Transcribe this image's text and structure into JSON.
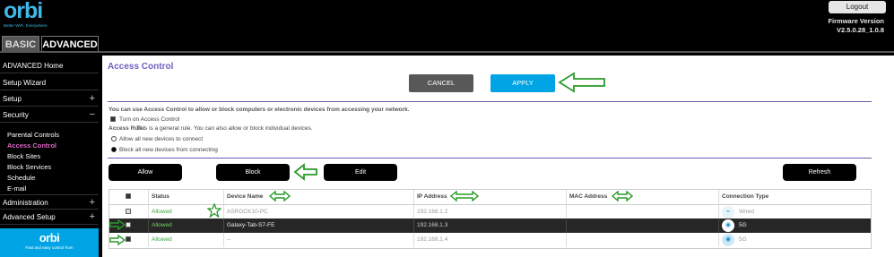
{
  "header": {
    "logo": "orbi",
    "logo_tagline": "Better WiFi. Everywhere.",
    "logout_label": "Logout",
    "firmware_label": "Firmware Version",
    "firmware_value": "V2.5.0.28_1.0.8",
    "tabs": [
      {
        "label": "BASIC",
        "active": false
      },
      {
        "label": "ADVANCED",
        "active": true
      }
    ]
  },
  "sidebar": {
    "items": [
      {
        "label": "ADVANCED Home",
        "expandable": false
      },
      {
        "label": "Setup Wizard",
        "expandable": false
      },
      {
        "label": "Setup",
        "expandable": true,
        "state": "+"
      },
      {
        "label": "Security",
        "expandable": true,
        "state": "−"
      },
      {
        "label": "Administration",
        "expandable": true,
        "state": "+"
      },
      {
        "label": "Advanced Setup",
        "expandable": true,
        "state": "+"
      }
    ],
    "security_subitems": [
      {
        "label": "Parental Controls",
        "active": false
      },
      {
        "label": "Access Control",
        "active": true
      },
      {
        "label": "Block Sites",
        "active": false
      },
      {
        "label": "Block Services",
        "active": false
      },
      {
        "label": "Schedule",
        "active": false
      },
      {
        "label": "E-mail",
        "active": false
      }
    ],
    "promo": {
      "logo": "orbi",
      "text": "Fast and easy control from"
    }
  },
  "main": {
    "title": "Access Control",
    "cancel_label": "CANCEL",
    "apply_label": "APPLY",
    "description": "You can use Access Control to allow or block computers or electronic devices from accessing your network.",
    "turn_on_label": "Turn on Access Control",
    "access_rule_label": "Access Rule:",
    "access_rule_text": "This is a general rule. You can also allow or block individual devices.",
    "radio_allow": "Allow all new devices to connect",
    "radio_block": "Block all new devices from connecting",
    "buttons": {
      "allow": "Allow",
      "block": "Block",
      "edit": "Edit",
      "refresh": "Refresh"
    },
    "table": {
      "headers": [
        "Status",
        "Device Name",
        "IP Address",
        "MAC Address",
        "Connection Type"
      ],
      "rows": [
        {
          "checked": false,
          "status": "Allowed",
          "device": "ASROCK10-PC",
          "ip": "192.168.1.2",
          "mac": "",
          "conn": "Wired",
          "icon": "wired-icon"
        },
        {
          "checked": true,
          "status": "Allowed",
          "device": "Galaxy-Tab-S7-FE",
          "ip": "192.168.1.3",
          "mac": "",
          "conn": "5G",
          "icon": "wifi-icon"
        },
        {
          "checked": true,
          "status": "Allowed",
          "device": "--",
          "ip": "192.168.1.4",
          "mac": "",
          "conn": "5G",
          "icon": "wifi-icon"
        }
      ]
    }
  },
  "colors": {
    "accent": "#00a4e4",
    "title": "#7060c0",
    "active_nav": "#e066c8",
    "annotation": "#2a9a2a",
    "allowed": "#3aa53a"
  }
}
